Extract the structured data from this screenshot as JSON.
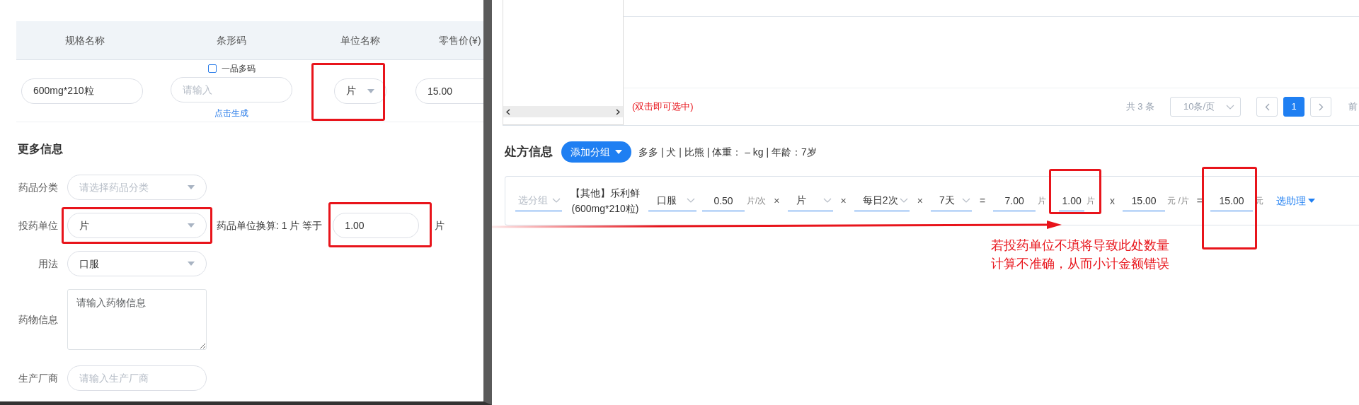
{
  "product_form": {
    "columns": [
      "规格名称",
      "条形码",
      "单位名称",
      "零售价(¥)"
    ],
    "spec_name": "600mg*210粒",
    "barcode": {
      "placeholder": "请输入",
      "multi_code_label": "一品多码",
      "multi_code_checked": false,
      "generate_link": "点击生成"
    },
    "unit": {
      "value": "片",
      "highlighted": true
    },
    "retail_price": "15.00"
  },
  "more_info": {
    "title": "更多信息",
    "fields": [
      {
        "kind": "select",
        "label": "药品分类",
        "placeholder": "请选择药品分类",
        "highlighted": false
      },
      {
        "kind": "select",
        "label": "投药单位",
        "value": "片",
        "highlighted": true,
        "conversion": {
          "label": "药品单位换算: 1 片 等于",
          "value": "1.00",
          "unit": "片",
          "highlighted": true
        }
      },
      {
        "kind": "select",
        "label": "用法",
        "value": "口服",
        "highlighted": false
      },
      {
        "kind": "textarea",
        "label": "药物信息",
        "placeholder": "请输入药物信息",
        "highlighted": false
      },
      {
        "kind": "input",
        "label": "生产厂商",
        "placeholder": "请输入生产厂商",
        "highlighted": false
      }
    ]
  },
  "search_results": {
    "hint": "(双击即可选中)",
    "total": "共 3 条",
    "page_size": "10条/页",
    "pages": [
      {
        "label": "1",
        "selected": true
      }
    ],
    "next_text": "前"
  },
  "prescription": {
    "title": "处方信息",
    "add_group_button": "添加分组",
    "patient_info": "多多 | 犬 | 比熊 | 体重： – kg | 年龄：7岁",
    "row": [
      {
        "kind": "select",
        "placeholder": "选分组"
      },
      {
        "kind": "drug",
        "lines": [
          "【其他】乐利鲜",
          "(600mg*210粒)"
        ]
      },
      {
        "kind": "select",
        "value": "口服"
      },
      {
        "kind": "input",
        "value": "0.50",
        "unit": "片/次",
        "highlighted": false
      },
      {
        "kind": "operator",
        "text": "×"
      },
      {
        "kind": "select",
        "value": "片"
      },
      {
        "kind": "operator",
        "text": "×"
      },
      {
        "kind": "select",
        "value": "每日2次"
      },
      {
        "kind": "operator",
        "text": "×"
      },
      {
        "kind": "select",
        "value": "7天"
      },
      {
        "kind": "operator",
        "text": "="
      },
      {
        "kind": "input",
        "value": "7.00",
        "unit": "片",
        "highlighted": false
      },
      {
        "kind": "input",
        "value": "1.00",
        "unit": "片",
        "highlighted": true
      },
      {
        "kind": "operator",
        "text": "x"
      },
      {
        "kind": "input",
        "value": "15.00",
        "unit": "元 /片",
        "highlighted": false
      },
      {
        "kind": "operator",
        "text": "="
      },
      {
        "kind": "input",
        "value": "15.00",
        "unit": "元",
        "highlighted": true
      },
      {
        "kind": "link",
        "text": "选助理"
      }
    ]
  },
  "annotation": {
    "lines": [
      "若投药单位不填将导致此处数量",
      "计算不准确，从而小计金额错误"
    ]
  }
}
